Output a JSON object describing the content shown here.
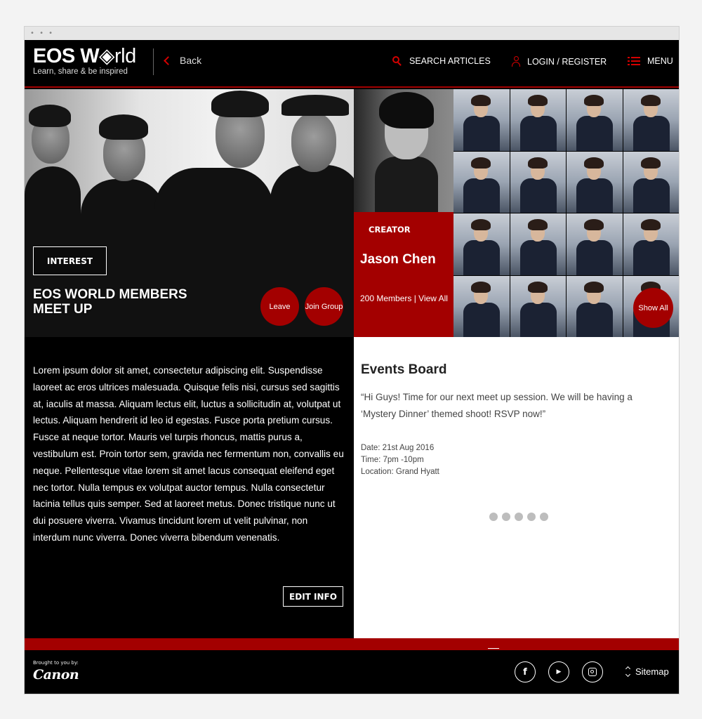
{
  "header": {
    "logo_title_bold": "EOS W",
    "logo_title_rest": "rld",
    "logo_tagline": "Learn, share & be inspired",
    "back_label": "Back",
    "search_label": "SEARCH ARTICLES",
    "login_label": "LOGIN / REGISTER",
    "menu_label": "MENU",
    "accent_color": "#d50000"
  },
  "hero": {
    "tag_label": "INTEREST",
    "title": "EOS WORLD MEMBERS MEET UP",
    "leave_label": "Leave",
    "join_label": "Join Group"
  },
  "creator": {
    "label": "CREATOR",
    "name": "Jason Chen",
    "members_text": "200 Members | View All",
    "show_all_label": "Show All",
    "box_color": "#a30000"
  },
  "description": {
    "text": "Lorem ipsum dolor sit amet, consectetur adipiscing elit. Suspendisse laoreet ac eros ultrices malesuada. Quisque felis nisi, cursus sed sagittis at, iaculis at massa. Aliquam lectus elit, luctus a sollicitudin at, volutpat ut lectus. Aliquam hendrerit id leo id egestas. Fusce porta pretium cursus. Fusce at neque tortor. Mauris vel turpis rhoncus, mattis purus a, vestibulum est. Proin tortor sem, gravida nec fermentum non, convallis eu neque. Pellentesque vitae lorem sit amet lacus consequat eleifend eget nec tortor. Nulla tempus ex volutpat auctor tempus. Nulla consectetur lacinia tellus quis semper. Sed at laoreet metus. Donec tristique nunc ut dui posuere viverra. Vivamus tincidunt lorem ut velit pulvinar, non interdum nunc viverra. Donec viverra bibendum venenatis.",
    "edit_label": "EDIT INFO"
  },
  "events": {
    "title": "Events Board",
    "quote": "“Hi Guys! Time for our next meet up session. We will be having a ‘Mystery Dinner’ themed shoot! RSVP now!”",
    "date": "Date: 21st Aug 2016",
    "time": "Time: 7pm -10pm",
    "location": "Location: Grand Hyatt",
    "pager_dots": 5
  },
  "footer": {
    "brought_by": "Brought to you by:",
    "brand": "Canon",
    "social_icons": [
      "facebook-icon",
      "youtube-icon",
      "instagram-icon"
    ],
    "sitemap_label": "Sitemap"
  }
}
